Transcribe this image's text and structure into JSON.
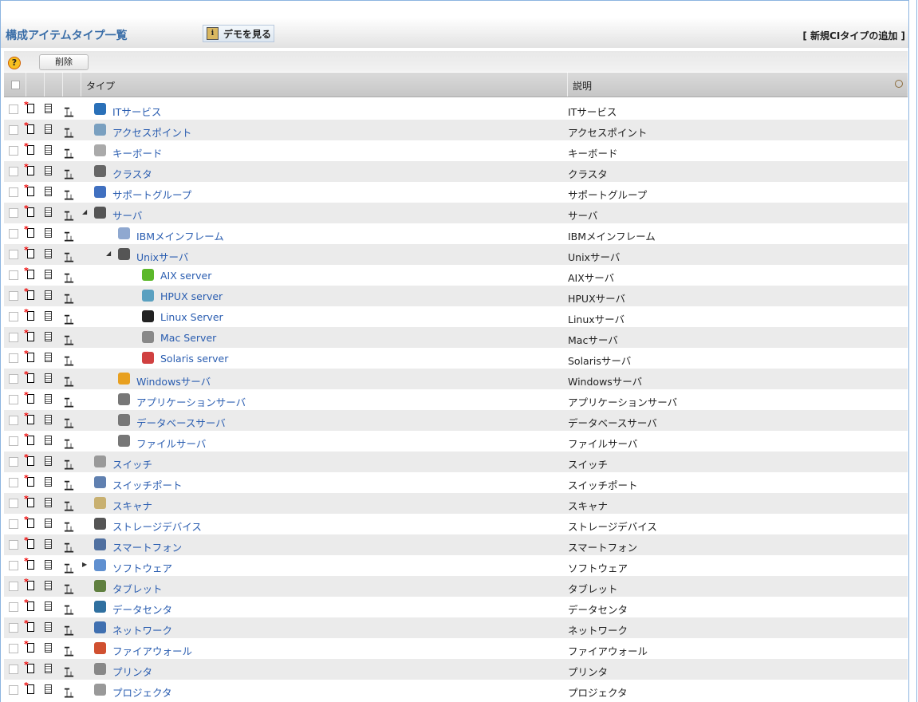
{
  "header": {
    "title": "構成アイテムタイプ一覧",
    "demo_label": "デモを見る",
    "add_label": "[ 新規CIタイプの追加 ]"
  },
  "toolbar": {
    "help": "?",
    "delete_label": "削除"
  },
  "table": {
    "col_type": "タイプ",
    "col_desc": "説明"
  },
  "colors": {
    "link": "#2a5db0",
    "stripe": "#ebebeb"
  },
  "rows": [
    {
      "name": "ITサービス",
      "desc": "ITサービス",
      "level": 0,
      "toggle": "",
      "icon": "globe-icon",
      "color": "#2a70b8"
    },
    {
      "name": "アクセスポイント",
      "desc": "アクセスポイント",
      "level": 0,
      "toggle": "",
      "icon": "antenna-icon",
      "color": "#7aa0c0"
    },
    {
      "name": "キーボード",
      "desc": "キーボード",
      "level": 0,
      "toggle": "",
      "icon": "keyboard-icon",
      "color": "#aaa"
    },
    {
      "name": "クラスタ",
      "desc": "クラスタ",
      "level": 0,
      "toggle": "",
      "icon": "cluster-icon",
      "color": "#666"
    },
    {
      "name": "サポートグループ",
      "desc": "サポートグループ",
      "level": 0,
      "toggle": "",
      "icon": "group-icon",
      "color": "#4070c0"
    },
    {
      "name": "サーバ",
      "desc": "サーバ",
      "level": 0,
      "toggle": "◢",
      "icon": "server-icon",
      "color": "#555"
    },
    {
      "name": "IBMメインフレーム",
      "desc": "IBMメインフレーム",
      "level": 1,
      "toggle": "",
      "icon": "ibm-icon",
      "color": "#8fa8d0"
    },
    {
      "name": "Unixサーバ",
      "desc": "Unixサーバ",
      "level": 1,
      "toggle": "◢",
      "icon": "server-icon",
      "color": "#555"
    },
    {
      "name": "AIX server",
      "desc": "AIXサーバ",
      "level": 2,
      "toggle": "",
      "icon": "aix-icon",
      "color": "#5cb82a"
    },
    {
      "name": "HPUX server",
      "desc": "HPUXサーバ",
      "level": 2,
      "toggle": "",
      "icon": "hp-icon",
      "color": "#5aa0c0"
    },
    {
      "name": "Linux Server",
      "desc": "Linuxサーバ",
      "level": 2,
      "toggle": "",
      "icon": "tux-icon",
      "color": "#222"
    },
    {
      "name": "Mac Server",
      "desc": "Macサーバ",
      "level": 2,
      "toggle": "",
      "icon": "apple-icon",
      "color": "#888"
    },
    {
      "name": "Solaris server",
      "desc": "Solarisサーバ",
      "level": 2,
      "toggle": "",
      "icon": "solaris-icon",
      "color": "#d04040"
    },
    {
      "name": "Windowsサーバ",
      "desc": "Windowsサーバ",
      "level": 1,
      "toggle": "",
      "icon": "windows-icon",
      "color": "#e8a020"
    },
    {
      "name": "アプリケーションサーバ",
      "desc": "アプリケーションサーバ",
      "level": 1,
      "toggle": "",
      "icon": "app-server-icon",
      "color": "#777"
    },
    {
      "name": "データベースサーバ",
      "desc": "データベースサーバ",
      "level": 1,
      "toggle": "",
      "icon": "db-server-icon",
      "color": "#777"
    },
    {
      "name": "ファイルサーバ",
      "desc": "ファイルサーバ",
      "level": 1,
      "toggle": "",
      "icon": "file-server-icon",
      "color": "#777"
    },
    {
      "name": "スイッチ",
      "desc": "スイッチ",
      "level": 0,
      "toggle": "",
      "icon": "switch-icon",
      "color": "#999"
    },
    {
      "name": "スイッチポート",
      "desc": "スイッチポート",
      "level": 0,
      "toggle": "",
      "icon": "switch-port-icon",
      "color": "#6080b0"
    },
    {
      "name": "スキャナ",
      "desc": "スキャナ",
      "level": 0,
      "toggle": "",
      "icon": "scanner-icon",
      "color": "#c8b070"
    },
    {
      "name": "ストレージデバイス",
      "desc": "ストレージデバイス",
      "level": 0,
      "toggle": "",
      "icon": "storage-icon",
      "color": "#555"
    },
    {
      "name": "スマートフォン",
      "desc": "スマートフォン",
      "level": 0,
      "toggle": "",
      "icon": "smartphone-icon",
      "color": "#5070a0"
    },
    {
      "name": "ソフトウェア",
      "desc": "ソフトウェア",
      "level": 0,
      "toggle": "▶",
      "icon": "software-icon",
      "color": "#6090d0"
    },
    {
      "name": "タブレット",
      "desc": "タブレット",
      "level": 0,
      "toggle": "",
      "icon": "tablet-icon",
      "color": "#608040"
    },
    {
      "name": "データセンタ",
      "desc": "データセンタ",
      "level": 0,
      "toggle": "",
      "icon": "datacenter-icon",
      "color": "#3070a0"
    },
    {
      "name": "ネットワーク",
      "desc": "ネットワーク",
      "level": 0,
      "toggle": "",
      "icon": "network-icon",
      "color": "#4070b0"
    },
    {
      "name": "ファイアウォール",
      "desc": "ファイアウォール",
      "level": 0,
      "toggle": "",
      "icon": "firewall-icon",
      "color": "#d05030"
    },
    {
      "name": "プリンタ",
      "desc": "プリンタ",
      "level": 0,
      "toggle": "",
      "icon": "printer-icon",
      "color": "#888"
    },
    {
      "name": "プロジェクタ",
      "desc": "プロジェクタ",
      "level": 0,
      "toggle": "",
      "icon": "projector-icon",
      "color": "#999"
    }
  ]
}
